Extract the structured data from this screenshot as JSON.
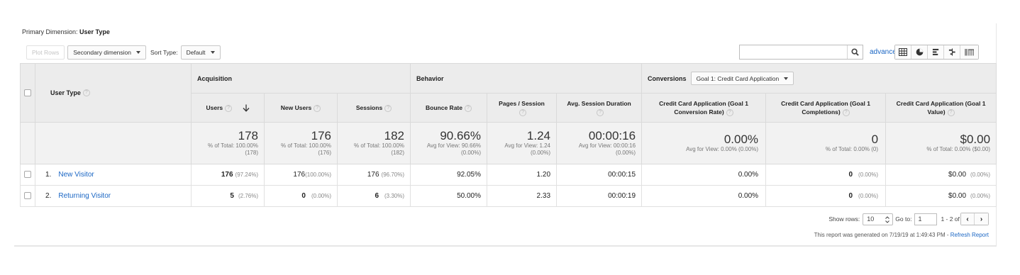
{
  "primary_dimension": {
    "label": "Primary Dimension:",
    "value": "User Type"
  },
  "toolbar": {
    "plot_rows": "Plot Rows",
    "secondary_dimension": "Secondary dimension",
    "sort_type_label": "Sort Type:",
    "sort_type_value": "Default",
    "search_placeholder": "",
    "advanced": "advanced"
  },
  "table": {
    "dimension_header": "User Type",
    "groups": {
      "acquisition": "Acquisition",
      "behavior": "Behavior",
      "conversions": "Conversions",
      "goal_select": "Goal 1: Credit Card Application"
    },
    "columns": {
      "users": "Users",
      "new_users": "New Users",
      "sessions": "Sessions",
      "bounce_rate": "Bounce Rate",
      "pages_session": "Pages / Session",
      "avg_duration": "Avg. Session Duration",
      "conv_rate": "Credit Card Application (Goal 1 Conversion Rate)",
      "completions": "Credit Card Application (Goal 1 Completions)",
      "value": "Credit Card Application (Goal 1 Value)"
    },
    "totals": {
      "users": {
        "big": "178",
        "sub1": "% of Total: 100.00%",
        "sub2": "(178)"
      },
      "new_users": {
        "big": "176",
        "sub1": "% of Total: 100.00%",
        "sub2": "(176)"
      },
      "sessions": {
        "big": "182",
        "sub1": "% of Total: 100.00%",
        "sub2": "(182)"
      },
      "bounce_rate": {
        "big": "90.66%",
        "sub1": "Avg for View: 90.66%",
        "sub2": "(0.00%)"
      },
      "pages_session": {
        "big": "1.24",
        "sub1": "Avg for View: 1.24",
        "sub2": "(0.00%)"
      },
      "avg_duration": {
        "big": "00:00:16",
        "sub1": "Avg for View: 00:00:16",
        "sub2": "(0.00%)"
      },
      "conv_rate": {
        "big": "0.00%",
        "sub1": "Avg for View: 0.00% (0.00%)"
      },
      "completions": {
        "big": "0",
        "sub1": "% of Total: 0.00% (0)"
      },
      "value": {
        "big": "$0.00",
        "sub1": "% of Total: 0.00% ($0.00)"
      }
    },
    "rows": [
      {
        "index": "1.",
        "name": "New Visitor",
        "users": "176",
        "users_pct": "(97.24%)",
        "new_users": "176",
        "new_users_pct": "(100.00%)",
        "sessions": "176",
        "sessions_pct": "(96.70%)",
        "bounce_rate": "92.05%",
        "pages_session": "1.20",
        "avg_duration": "00:00:15",
        "conv_rate": "0.00%",
        "completions": "0",
        "completions_pct": "(0.00%)",
        "value": "$0.00",
        "value_pct": "(0.00%)"
      },
      {
        "index": "2.",
        "name": "Returning Visitor",
        "users": "5",
        "users_pct": "(2.76%)",
        "new_users": "0",
        "new_users_pct": "(0.00%)",
        "sessions": "6",
        "sessions_pct": "(3.30%)",
        "bounce_rate": "50.00%",
        "pages_session": "2.33",
        "avg_duration": "00:00:19",
        "conv_rate": "0.00%",
        "completions": "0",
        "completions_pct": "(0.00%)",
        "value": "$0.00",
        "value_pct": "(0.00%)"
      }
    ]
  },
  "footer": {
    "show_rows_label": "Show rows:",
    "show_rows_value": "10",
    "goto_label": "Go to:",
    "goto_value": "1",
    "range": "1 - 2 of 2",
    "prev": "‹",
    "next": "›",
    "generated": "This report was generated on 7/19/19 at 1:49:43 PM -",
    "refresh": "Refresh Report"
  },
  "colors": {
    "link": "#1a66c4",
    "header_bg": "#ececec",
    "totals_bg": "#f2f2f2"
  }
}
